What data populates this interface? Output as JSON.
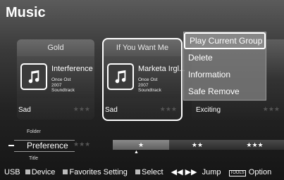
{
  "header": {
    "title": "Music"
  },
  "cards": [
    {
      "title": "Gold",
      "track": "Interference",
      "meta": [
        "Once Ost",
        "2007",
        "Soundtrack"
      ],
      "mood": "Sad",
      "stars": "★★★"
    },
    {
      "title": "If You Want Me",
      "track": "Marketa Irgl...",
      "meta": [
        "Once Ost",
        "2007",
        "Soundtrack"
      ],
      "mood": "Sad",
      "stars": "★★★"
    },
    {
      "mood": "Exciting",
      "stars": "★★★"
    }
  ],
  "context_menu": {
    "items": [
      {
        "label": "Play Current Group",
        "active": true
      },
      {
        "label": "Delete"
      },
      {
        "label": "Information"
      },
      {
        "label": "Safe Remove"
      }
    ]
  },
  "sort": {
    "above": "Folder",
    "current": "Preference",
    "below": "Title",
    "left_stars": "★★★",
    "segments": [
      {
        "label": "★",
        "highlighted": true
      },
      {
        "label": "★★"
      },
      {
        "label": "★★★"
      }
    ],
    "caret": "▲"
  },
  "footer": {
    "source": "USB",
    "device": "Device",
    "favorites": "Favorites Setting",
    "select": "Select",
    "jump_symbol": "◀◀ ▶▶",
    "jump": "Jump",
    "tools_key": "TOOLS",
    "option": "Option"
  },
  "colors": {
    "selection_outline": "#ffffff",
    "menu_bg": "#787878"
  }
}
